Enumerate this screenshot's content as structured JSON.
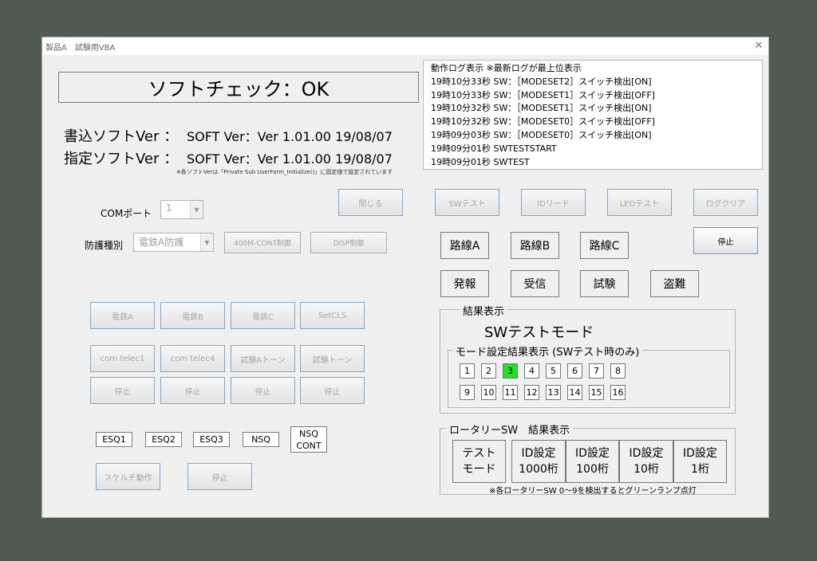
{
  "window": {
    "title": "製品A　試験用VBA",
    "close": "✕"
  },
  "check": {
    "status": "ソフトチェック：OK"
  },
  "version": {
    "write_label": "書込ソフトVer ：",
    "write_value": "SOFT Ver：Ver 1.01.00 19/08/07",
    "spec_label": "指定ソフトVer ：",
    "spec_value": "SOFT Ver：Ver 1.01.00 19/08/07",
    "note": "※各ソフトVerは「Private Sub UserForm_Initialize()」に固定値で設定されています"
  },
  "log": {
    "header": "動作ログ表示 ※最新ログが最上位表示",
    "lines": [
      "19時10分33秒 SW：［MODESET2］スイッチ検出[ON]",
      "19時10分33秒 SW：［MODESET1］スイッチ検出[OFF]",
      "19時10分32秒 SW：［MODESET1］スイッチ検出[ON]",
      "19時10分32秒 SW：［MODESET0］スイッチ検出[OFF]",
      "19時09分03秒 SW：［MODESET0］スイッチ検出[ON]",
      "19時09分01秒 SWTESTSTART",
      "19時09分01秒 SWTEST"
    ]
  },
  "com": {
    "label": "COMポート",
    "value": "1"
  },
  "protect": {
    "label": "防護種別",
    "value": "電鉄A防護"
  },
  "buttons": {
    "close": "閉じる",
    "swtest": "SWテスト",
    "idread": "IDリード",
    "ledtest": "LEDテスト",
    "logclear": "ログクリア",
    "stop_main": "停止",
    "ctrl400m": "400M-CONT制御",
    "disp": "DISP制御",
    "dentetsu_a": "電鉄A",
    "dentetsu_b": "電鉄B",
    "dentetsu_c": "電鉄C",
    "setcls": "SetCLS",
    "telec1": "com telec1",
    "telec4": "com telec4",
    "test_a_tone": "試験Aトーン",
    "test_tone": "試験トーン",
    "stop1": "停止",
    "stop2": "停止",
    "stop3": "停止",
    "stop4": "停止",
    "squelch": "スケルチ動作",
    "squelch_stop": "停止"
  },
  "routes": [
    "路線A",
    "路線B",
    "路線C"
  ],
  "signals": [
    "発報",
    "受信",
    "試験",
    "盗難"
  ],
  "esq": [
    "ESQ1",
    "ESQ2",
    "ESQ3",
    "NSQ",
    "NSQ\nCONT"
  ],
  "result": {
    "legend": "結果表示",
    "mode": "SWテストモード",
    "mode_legend": "モード設定結果表示 (SWテスト時のみ)",
    "numbers": [
      "1",
      "2",
      "3",
      "4",
      "5",
      "6",
      "7",
      "8",
      "9",
      "10",
      "11",
      "12",
      "13",
      "14",
      "15",
      "16"
    ],
    "active": "3",
    "active_color": "#22e022"
  },
  "rotary": {
    "legend": "ロータリーSW　結果表示",
    "items": [
      "テスト\nモード",
      "ID設定\n1000桁",
      "ID設定\n100桁",
      "ID設定\n10桁",
      "ID設定\n1桁"
    ],
    "note": "※各ロータリーSW 0～9を検出するとグリーンランプ点灯"
  }
}
